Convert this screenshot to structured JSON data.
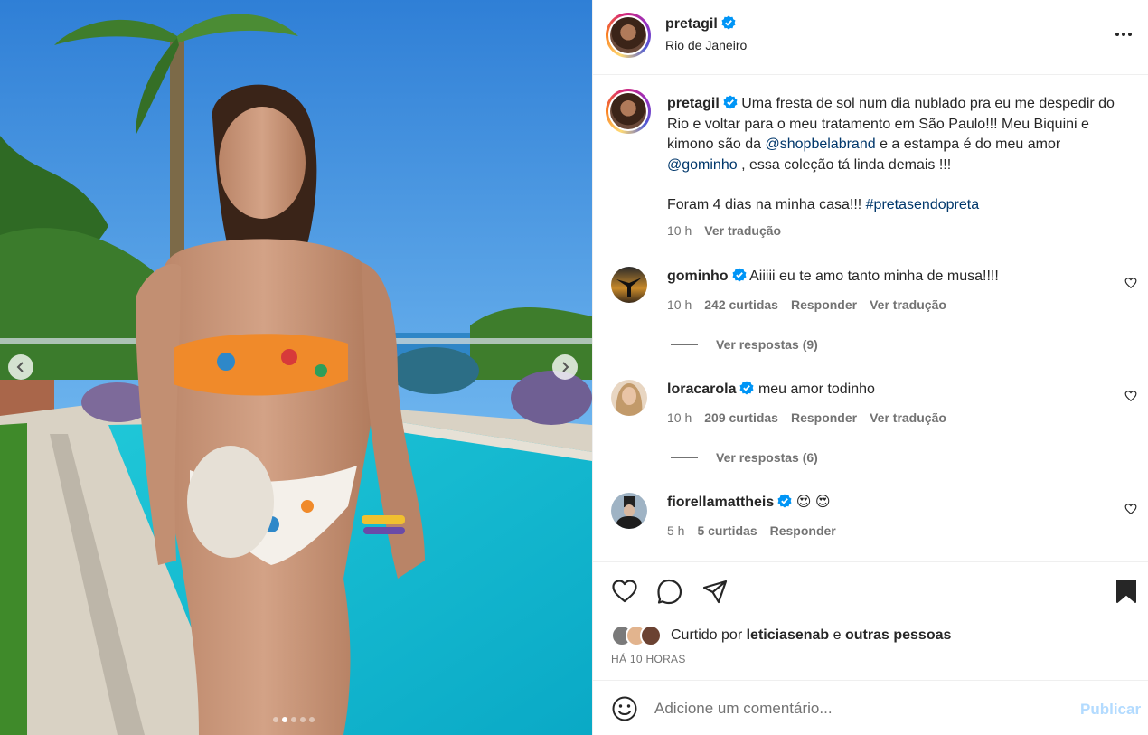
{
  "post": {
    "username": "pretagil",
    "location": "Rio de Janeiro"
  },
  "caption": {
    "username": "pretagil",
    "line1": "Uma fresta de sol num dia nublado pra eu me despedir do Rio e voltar para o meu tratamento em São Paulo!!! Meu Biquini e kimono são da ",
    "mention1": "@shopbelabrand",
    "line2": " e a estampa é do meu amor ",
    "mention2": "@gominho",
    "line3": " , essa coleção tá linda demais !!!",
    "line4": "Foram 4 dias na minha casa!!! ",
    "hashtag": "#pretasendopreta",
    "time": "10 h",
    "translate": "Ver tradução"
  },
  "comments": [
    {
      "username": "gominho",
      "text": "Aiiiii eu te amo tanto minha de musa!!!!",
      "time": "10 h",
      "likes": "242 curtidas",
      "reply": "Responder",
      "translate": "Ver tradução",
      "replies": "Ver respostas (9)"
    },
    {
      "username": "loracarola",
      "text": "meu amor todinho",
      "time": "10 h",
      "likes": "209 curtidas",
      "reply": "Responder",
      "translate": "Ver tradução",
      "replies": "Ver respostas (6)"
    },
    {
      "username": "fiorellamattheis",
      "text": "😍 😍",
      "time": "5 h",
      "likes": "5 curtidas",
      "reply": "Responder"
    }
  ],
  "likes": {
    "prefix": "Curtido por ",
    "user": "leticiasenab",
    "middle": " e ",
    "others": "outras pessoas",
    "time_ago": "HÁ 10 HORAS"
  },
  "add_comment": {
    "placeholder": "Adicione um comentário...",
    "publish": "Publicar"
  },
  "icons": {
    "like": "heart-icon",
    "comment": "comment-icon",
    "share": "send-icon",
    "save": "bookmark-icon",
    "emoji": "emoji-icon",
    "more": "more-options-icon",
    "verified": "verified-badge-icon"
  },
  "colors": {
    "link": "#00376b",
    "verified": "#0095f6",
    "muted": "#737373",
    "publish_disabled": "#b3dbff"
  }
}
